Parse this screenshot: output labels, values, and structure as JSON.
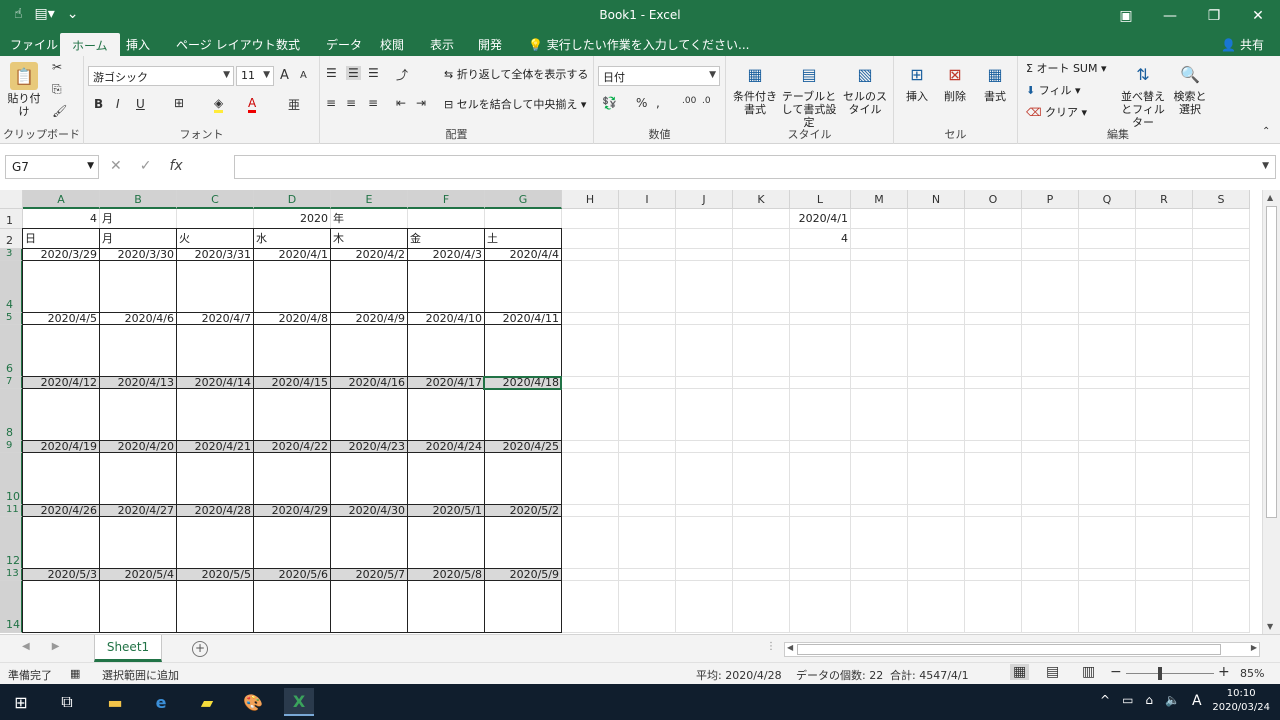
{
  "window": {
    "title": "Book1 - Excel"
  },
  "tabs": {
    "file": "ファイル",
    "home": "ホーム",
    "insert": "挿入",
    "pagelayout": "ページ レイアウト",
    "formulas": "数式",
    "data": "データ",
    "review": "校閲",
    "view": "表示",
    "developer": "開発",
    "tellme": "実行したい作業を入力してください...",
    "share": "共有"
  },
  "ribbon": {
    "paste": "貼り付け",
    "clipboard": "クリップボード",
    "font_name": "游ゴシック",
    "font_size": "11",
    "font": "フォント",
    "wrap_text": "折り返して全体を表示する",
    "merge_center": "セルを結合して中央揃え",
    "alignment": "配置",
    "number_format": "日付",
    "number": "数値",
    "cond_format": "条件付き書式",
    "format_table": "テーブルとして書式設定",
    "cell_styles": "セルのスタイル",
    "styles": "スタイル",
    "insert": "挿入",
    "delete": "削除",
    "format": "書式",
    "cells": "セル",
    "autosum": "オート SUM",
    "fill": "フィル",
    "clear": "クリア",
    "sort_filter": "並べ替えとフィルター",
    "find_select": "検索と選択",
    "editing": "編集",
    "bold": "B",
    "italic": "I",
    "underline": "U",
    "inc_font": "A",
    "dec_font": "A",
    "percent": "%",
    "comma": "⁹"
  },
  "formula": {
    "namebox": "G7",
    "cancel": "✕",
    "enter": "✓",
    "fx": "fx",
    "value": ""
  },
  "columns": [
    "A",
    "B",
    "C",
    "D",
    "E",
    "F",
    "G",
    "H",
    "I",
    "J",
    "K",
    "L",
    "M",
    "N",
    "O",
    "P",
    "Q",
    "R",
    "S"
  ],
  "rows": [
    "1",
    "2",
    "3",
    "4",
    "5",
    "6",
    "7",
    "8",
    "9",
    "10",
    "11",
    "12",
    "13",
    "14"
  ],
  "cells": {
    "A1": "4",
    "B1": "月",
    "D1": "2020",
    "E1": "年",
    "L1": "2020/4/1",
    "L2": "4",
    "weekdays": [
      "日",
      "月",
      "火",
      "水",
      "木",
      "金",
      "土"
    ],
    "weeks": [
      [
        "2020/3/29",
        "2020/3/30",
        "2020/3/31",
        "2020/4/1",
        "2020/4/2",
        "2020/4/3",
        "2020/4/4"
      ],
      [
        "2020/4/5",
        "2020/4/6",
        "2020/4/7",
        "2020/4/8",
        "2020/4/9",
        "2020/4/10",
        "2020/4/11"
      ],
      [
        "2020/4/12",
        "2020/4/13",
        "2020/4/14",
        "2020/4/15",
        "2020/4/16",
        "2020/4/17",
        "2020/4/18"
      ],
      [
        "2020/4/19",
        "2020/4/20",
        "2020/4/21",
        "2020/4/22",
        "2020/4/23",
        "2020/4/24",
        "2020/4/25"
      ],
      [
        "2020/4/26",
        "2020/4/27",
        "2020/4/28",
        "2020/4/29",
        "2020/4/30",
        "2020/5/1",
        "2020/5/2"
      ],
      [
        "2020/5/3",
        "2020/5/4",
        "2020/5/5",
        "2020/5/6",
        "2020/5/7",
        "2020/5/8",
        "2020/5/9"
      ]
    ]
  },
  "sheet": {
    "name": "Sheet1"
  },
  "status": {
    "ready": "準備完了",
    "add_selection": "選択範囲に追加",
    "average": "平均: 2020/4/28",
    "count": "データの個数: 22",
    "sum": "合計: 4547/4/1",
    "zoom": "85%"
  },
  "taskbar": {
    "time": "10:10",
    "date": "2020/03/24",
    "ime": "A"
  }
}
